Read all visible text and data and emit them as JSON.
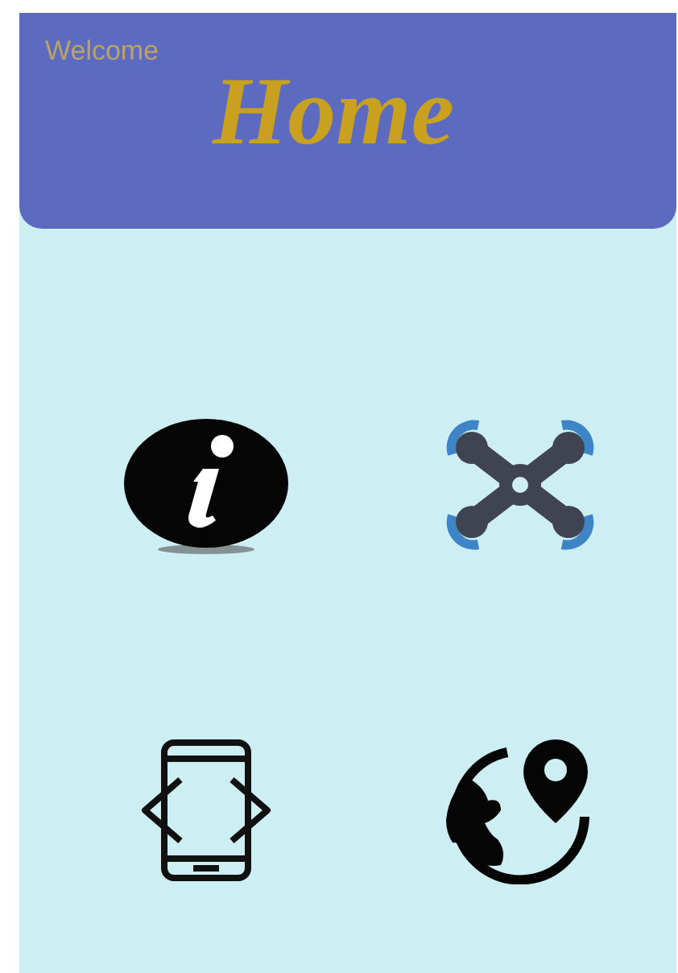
{
  "header": {
    "greeting": "Welcome",
    "title": "Home"
  },
  "tiles": [
    {
      "kind": "info"
    },
    {
      "kind": "drone"
    },
    {
      "kind": "mobile-code"
    },
    {
      "kind": "globe-pin"
    }
  ]
}
